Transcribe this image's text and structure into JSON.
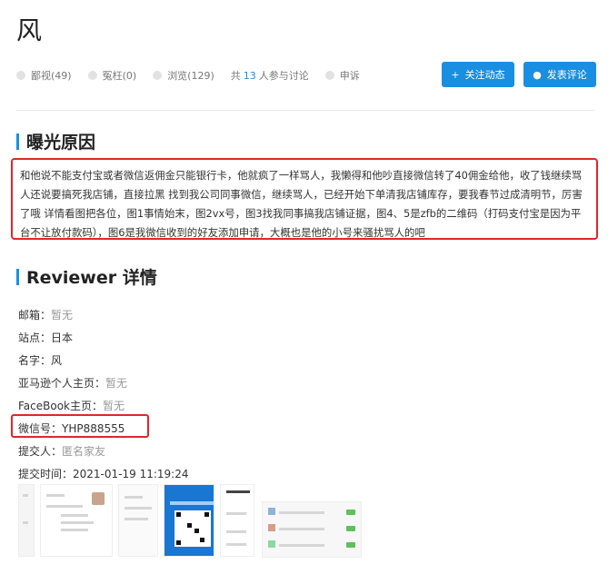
{
  "page": {
    "title": "风"
  },
  "meta": {
    "views": "鄙视(49)",
    "support": "冤枉(0)",
    "browse": "浏览(129)",
    "discuss_prefix": "共",
    "discuss_count": "13",
    "discuss_suffix": "人参与讨论",
    "appeal": "申诉"
  },
  "actions": {
    "follow": "关注动态",
    "comment": "发表评论"
  },
  "sections": {
    "reason_title": "曝光原因",
    "reviewer_title": "Reviewer 详情"
  },
  "reason": {
    "text": "和他说不能支付宝或者微信返佣金只能银行卡，他就疯了一样骂人，我懒得和他吵直接微信转了40佣金给他，收了钱继续骂人还说要搞死我店铺，直接拉黑 找到我公司同事微信，继续骂人，已经开始下单清我店铺库存，要我春节过成清明节，厉害了哦 详情看图把各位，图1事情始末，图2vx号，图3找我同事搞我店铺证据，图4、5是zfb的二维码（打码支付宝是因为平台不让放付款码），图6是我微信收到的好友添加申请，大概也是他的小号来骚扰骂人的吧"
  },
  "details": {
    "email_label": "邮箱：",
    "email_value": "暂无",
    "site_label": "站点：",
    "site_value": "日本",
    "name_label": "名字：",
    "name_value": "风",
    "amazon_label": "亚马逊个人主页：",
    "amazon_value": "暂无",
    "facebook_label": "FaceBook主页：",
    "facebook_value": "暂无",
    "wechat_label": "微信号：",
    "wechat_value": "YHP888555",
    "submitter_label": "提交人：",
    "submitter_value": "匿名家友",
    "time_label": "提交时间：",
    "time_value": "2021-01-19 11:19:24"
  },
  "colors": {
    "accent": "#1a8ee0",
    "highlight": "#e0262b"
  }
}
